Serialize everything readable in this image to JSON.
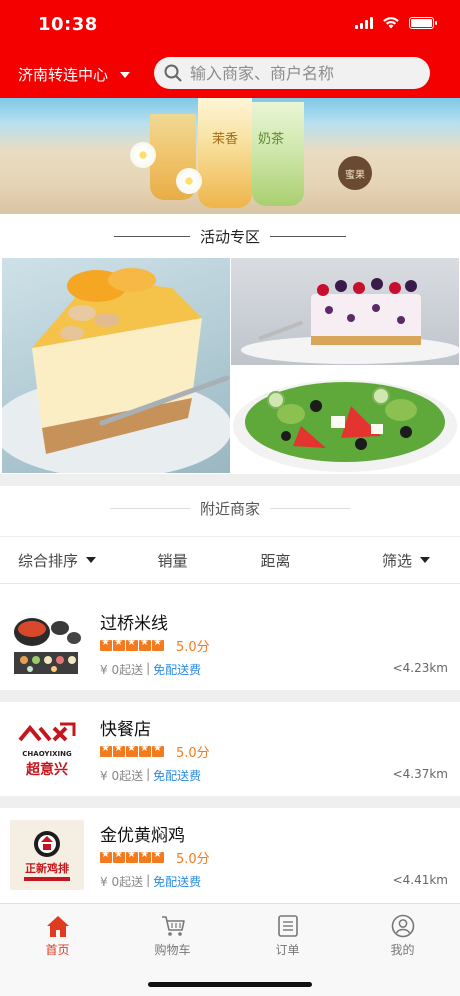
{
  "status_bar": {
    "time": "10:38"
  },
  "header": {
    "city": "济南转连中心",
    "search_placeholder": "输入商家、商户名称"
  },
  "banner": {
    "logo_text": "蜜果",
    "cup_labels": [
      "茉香",
      "奶茶"
    ]
  },
  "sections": {
    "activity_title": "活动专区",
    "nearby_title": "附近商家"
  },
  "sort_bar": {
    "items": [
      "综合排序",
      "销量",
      "距离",
      "筛选"
    ]
  },
  "merchants": [
    {
      "name": "过桥米线",
      "rating_stars": 5,
      "score": "5.0分",
      "min_order": "¥ 0起送",
      "separator": "|",
      "free_delivery": "免配送费",
      "distance": "<4.23km"
    },
    {
      "name": "快餐店",
      "rating_stars": 5,
      "score": "5.0分",
      "min_order": "¥ 0起送",
      "separator": "|",
      "free_delivery": "免配送费",
      "distance": "<4.37km",
      "logo_text_top": "CHAOYIXING",
      "logo_text_bottom": "超意兴"
    },
    {
      "name": "金优黄焖鸡",
      "rating_stars": 5,
      "score": "5.0分",
      "min_order": "¥ 0起送",
      "separator": "|",
      "free_delivery": "免配送费",
      "distance": "<4.41km",
      "logo_text": "正新鸡排"
    }
  ],
  "tabbar": {
    "items": [
      {
        "label": "首页",
        "icon": "home-icon",
        "active": true
      },
      {
        "label": "购物车",
        "icon": "cart-icon",
        "active": false
      },
      {
        "label": "订单",
        "icon": "order-list-icon",
        "active": false
      },
      {
        "label": "我的",
        "icon": "profile-icon",
        "active": false
      }
    ]
  },
  "colors": {
    "brand_red": "#f40000",
    "star_orange": "#f37b1d",
    "link_blue": "#2b8ce6",
    "tab_active": "#e03a1f"
  }
}
